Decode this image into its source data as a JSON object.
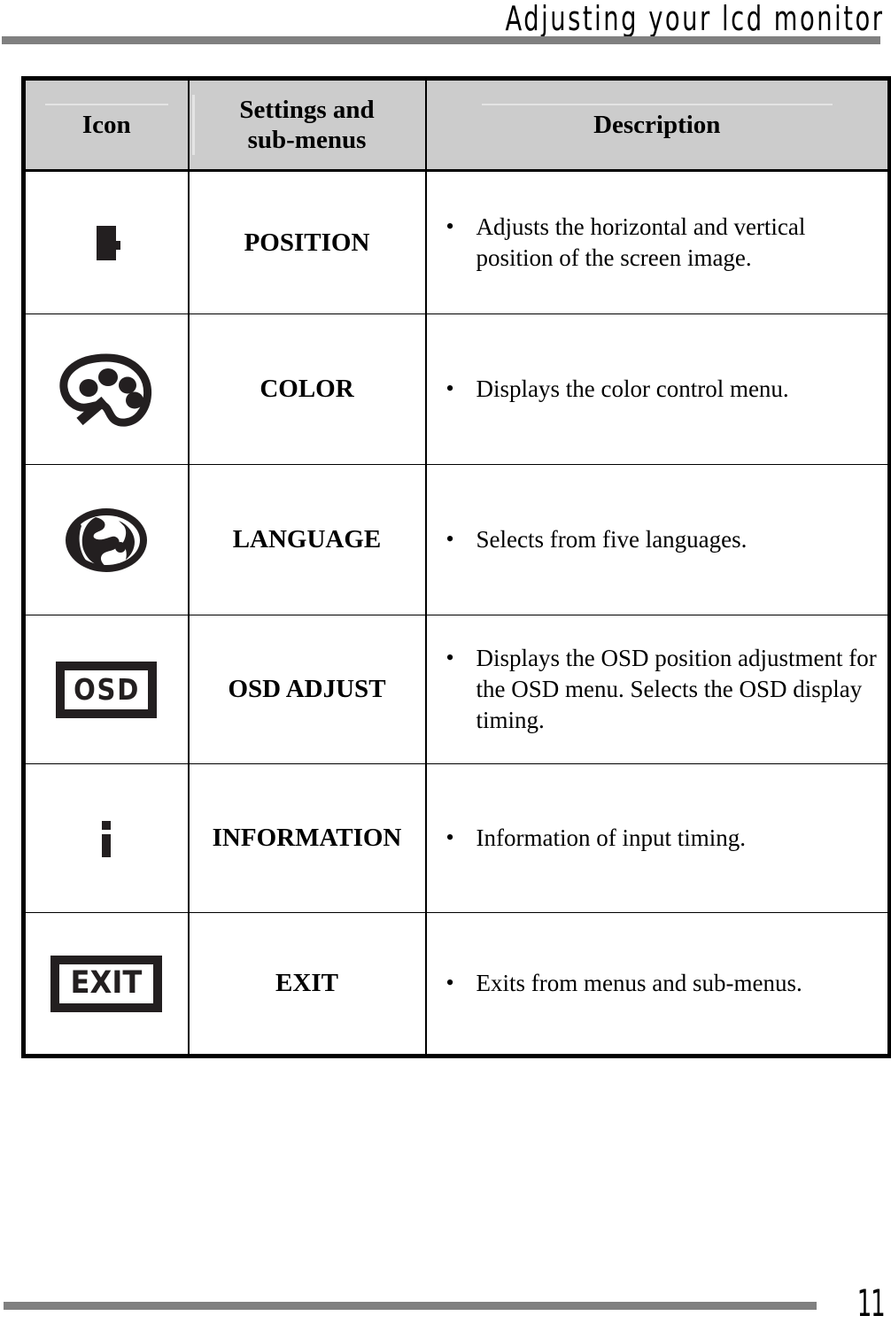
{
  "header": {
    "title": "Adjusting your lcd monitor",
    "rule_color": "#808080"
  },
  "table": {
    "columns": [
      {
        "key": "icon",
        "label": "Icon"
      },
      {
        "key": "label",
        "label": "Settings and\nsub-menus"
      },
      {
        "key": "desc",
        "label": "Description"
      }
    ],
    "column_headers": {
      "icon": "Icon",
      "settings_line1": "Settings and",
      "settings_line2": "sub-menus",
      "description": "Description"
    },
    "header_background": "#cccccc",
    "border_color": "#000000",
    "rows": [
      {
        "icon_name": "position-icon",
        "icon_text": "",
        "label": "POSITION",
        "bullet": "•",
        "description": "Adjusts the horizontal and vertical position of the screen image."
      },
      {
        "icon_name": "color-palette-icon",
        "icon_text": "",
        "label": "COLOR",
        "bullet": "•",
        "description": "Displays the color control menu."
      },
      {
        "icon_name": "globe-language-icon",
        "icon_text": "",
        "label": "LANGUAGE",
        "bullet": "•",
        "description": "Selects from five languages."
      },
      {
        "icon_name": "osd-icon",
        "icon_text": "OSD",
        "label": "OSD ADJUST",
        "bullet": "•",
        "description": "Displays the OSD position adjustment for the OSD menu. Selects the OSD display timing."
      },
      {
        "icon_name": "information-icon",
        "icon_text": "i",
        "label": "INFORMATION",
        "bullet": "•",
        "description": "Information of input timing."
      },
      {
        "icon_name": "exit-icon",
        "icon_text": "EXIT",
        "label": "EXIT",
        "bullet": "•",
        "description": "Exits from menus and sub-menus."
      }
    ]
  },
  "footer": {
    "page_number": "11",
    "rule_color": "#808080"
  }
}
